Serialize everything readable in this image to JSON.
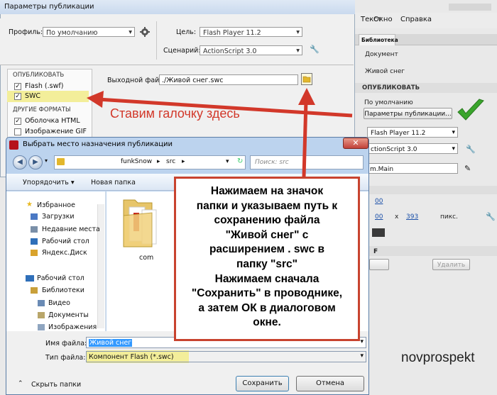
{
  "bg_app": {
    "menu": [
      "Текст",
      "Окно",
      "Справка"
    ],
    "library_tab": "Библиотека",
    "items": [
      "Документ",
      "Живой снег"
    ],
    "publish_section": "ОПУБЛИКОВАТЬ",
    "profile_label": "Профиль:",
    "profile_value": "По умолчанию",
    "publish_settings_button": "Параметры публикации...",
    "target_value": "Flash Player 11.2",
    "script_value": "ctionScript 3.0",
    "class_value": "m.Main",
    "num_left": "00",
    "num_w": "00",
    "num_h": "393",
    "unit": "пикс.",
    "delete_button": "Удалить",
    "f_label": "F"
  },
  "pub_dialog": {
    "title": "Параметры публикации",
    "profile_label": "Профиль:",
    "profile_value": "По умолчанию",
    "target_label": "Цель:",
    "target_value": "Flash Player 11.2",
    "script_label": "Сценарий:",
    "script_value": "ActionScript 3.0",
    "publish_header": "ОПУБЛИКОВАТЬ",
    "flash_label": "Flash (.swf)",
    "swc_label": "SWC",
    "other_formats": "ДРУГИЕ ФОРМАТЫ",
    "html_label": "Оболочка HTML",
    "gif_label": "Изображение GIF",
    "output_label": "Выходной файл:",
    "output_value": "./Живой снег.swc"
  },
  "save_dialog": {
    "title": "Выбрать место назначения публикации",
    "path_parts": [
      "funkSnow",
      "src"
    ],
    "search_placeholder": "Поиск: src",
    "organize": "Упорядочить ▾",
    "new_folder": "Новая папка",
    "nav_items": [
      {
        "label": "Избранное",
        "icon": "star-icon"
      },
      {
        "label": "Загрузки",
        "icon": "downloads-folder-icon"
      },
      {
        "label": "Недавние места",
        "icon": "recent-places-icon"
      },
      {
        "label": "Рабочий стол",
        "icon": "desktop-icon"
      },
      {
        "label": "Яндекс.Диск",
        "icon": "yandex-disk-icon"
      },
      {
        "label": "Рабочий стол",
        "icon": "desktop-icon"
      },
      {
        "label": "Библиотеки",
        "icon": "libraries-icon"
      },
      {
        "label": "Видео",
        "icon": "video-library-icon"
      },
      {
        "label": "Документы",
        "icon": "documents-library-icon"
      },
      {
        "label": "Изображения",
        "icon": "images-library-icon"
      }
    ],
    "folder_name": "com",
    "filename_label": "Имя файла:",
    "filename_value": "Живой снег",
    "filetype_label": "Тип файла:",
    "filetype_value": "Компонент Flash (*.swc)",
    "hide_folders": "Скрыть папки",
    "save_button": "Сохранить",
    "cancel_button": "Отмена"
  },
  "annotations": {
    "checkbox_note": "Ставим галочку здесь",
    "instructions": "Нажимаем на значок\nпапки и указываем путь к\nсохранению файла\n\"Живой снег\" с\nрасширением . swc в\nпапку  \"src\"\nНажимаем сначала\n\"Сохранить\" в проводнике,\nа затем ОК в диалоговом\nокне.",
    "watermark": "novprospekt",
    "arrow_color": "#d2382a",
    "highlight_color": "#f3ee9a",
    "checkmark_color": "#3aa52c"
  }
}
